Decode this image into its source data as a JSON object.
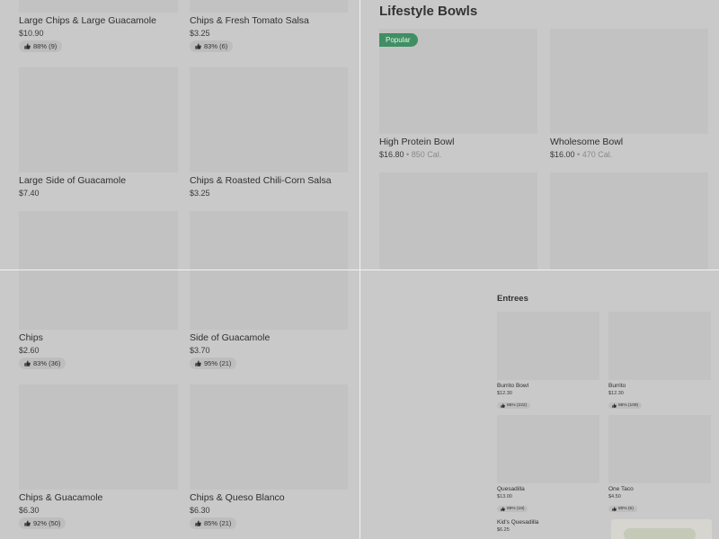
{
  "panel_tl": {
    "items": [
      {
        "name": "Large Chips & Large Guacamole",
        "price": "$10.90",
        "rating": "88% (9)"
      },
      {
        "name": "Chips & Fresh Tomato Salsa",
        "price": "$3.25",
        "rating": "83% (6)"
      },
      {
        "name": "Large Side of Guacamole",
        "price": "$7.40",
        "rating": ""
      },
      {
        "name": "Chips & Roasted Chili-Corn Salsa",
        "price": "$3.25",
        "rating": ""
      }
    ]
  },
  "panel_tr": {
    "section_title": "Lifestyle Bowls",
    "badge": "Popular",
    "items": [
      {
        "name": "High Protein Bowl",
        "price": "$16.80",
        "cal": "850 Cal."
      },
      {
        "name": "Wholesome Bowl",
        "price": "$16.00",
        "cal": "470 Cal."
      }
    ]
  },
  "panel_bl": {
    "items": [
      {
        "name": "Chips",
        "price": "$2.60",
        "rating": "83% (36)"
      },
      {
        "name": "Side of Guacamole",
        "price": "$3.70",
        "rating": "95% (21)"
      },
      {
        "name": "Chips & Guacamole",
        "price": "$6.30",
        "rating": "92% (50)"
      },
      {
        "name": "Chips & Queso Blanco",
        "price": "$6.30",
        "rating": "85% (21)"
      }
    ]
  },
  "panel_br": {
    "section_title": "Entrees",
    "items": [
      {
        "name": "Burrito Bowl",
        "price": "$12.30",
        "rating": "85% (222)"
      },
      {
        "name": "Burrito",
        "price": "$12.30",
        "rating": "86% (109)"
      },
      {
        "name": "Quesadilla",
        "price": "$13.00",
        "rating": "89% (18)"
      },
      {
        "name": "One Taco",
        "price": "$4.50",
        "rating": "80% (5)"
      },
      {
        "name": "Kid's Quesadilla",
        "price": "$6.25",
        "rating": ""
      }
    ]
  },
  "icons": {
    "rating": "thumbs-up-icon"
  },
  "colors": {
    "popular_badge": "#3f8f62",
    "background": "#c8c8c8",
    "divider": "#f2f2f2"
  }
}
